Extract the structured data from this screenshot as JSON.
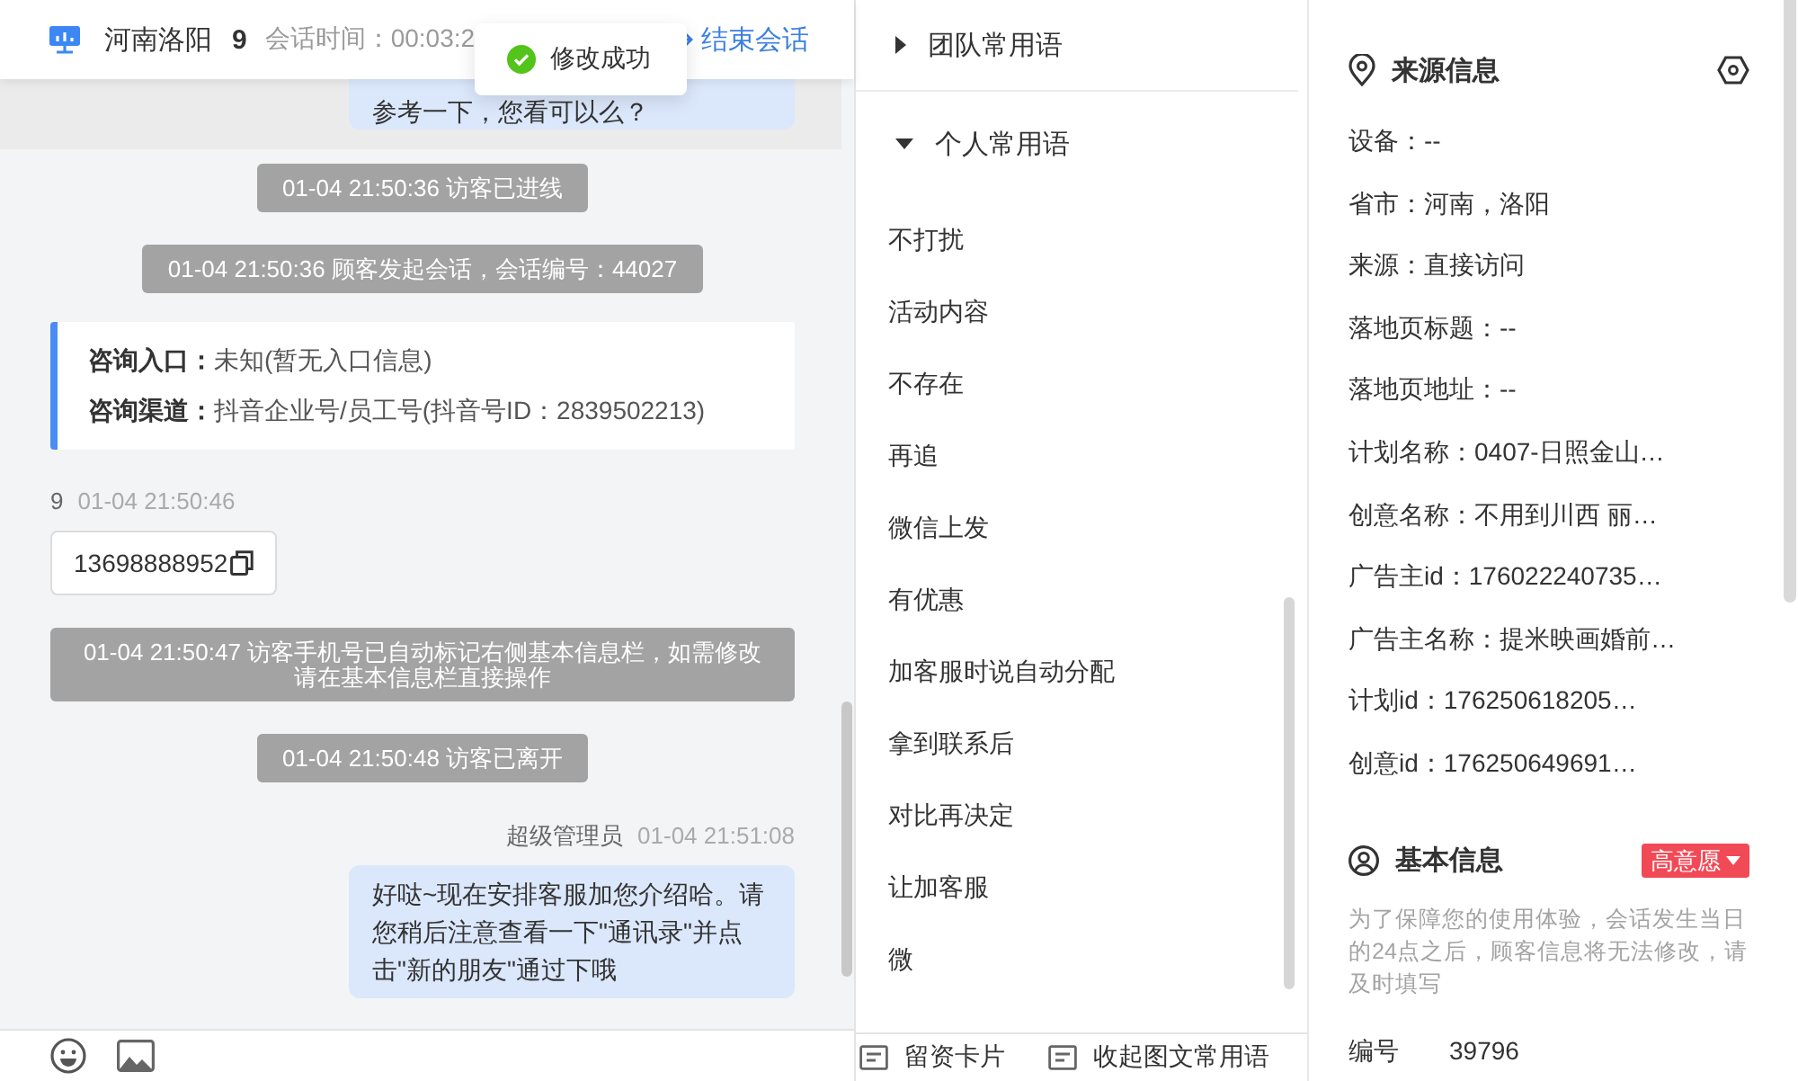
{
  "header": {
    "location": "河南洛阳",
    "visitor_number": "9",
    "session_time": "会话时间：00:03:2",
    "end_button": "结束会话"
  },
  "toast": {
    "message": "修改成功"
  },
  "chat": {
    "messages": [
      {
        "kind": "agent_partial",
        "text": "参考一下，您看可以么？"
      },
      {
        "kind": "system",
        "text": "01-04 21:50:36 访客已进线"
      },
      {
        "kind": "system",
        "text": "01-04 21:50:36 顾客发起会话，会话编号：44027"
      },
      {
        "kind": "info_card",
        "lines": [
          "**咨询入口：**未知(暂无入口信息)",
          "**咨询渠道：**抖音企业号/员工号(抖音号ID：2839502213)"
        ]
      },
      {
        "kind": "visitor",
        "sender": "9",
        "time": "01-04 21:50:46",
        "text": "13698888952"
      },
      {
        "kind": "system",
        "text": "01-04 21:50:47 访客手机号已自动标记右侧基本信息栏，如需修改请在基本信息栏直接操作"
      },
      {
        "kind": "system",
        "text": "01-04 21:50:48 访客已离开"
      },
      {
        "kind": "agent",
        "sender": "超级管理员",
        "time": "01-04 21:51:08",
        "text": "好哒~现在安排客服加您介绍哈。请您稍后注意查看一下\"通讯录\"并点击\"新的朋友\"通过下哦"
      }
    ]
  },
  "phrases": {
    "groups": [
      {
        "title": "团队常用语",
        "expanded": false
      },
      {
        "title": "个人常用语",
        "expanded": true,
        "items": [
          "不打扰",
          "活动内容",
          "不存在",
          "再追",
          "微信上发",
          "有优惠",
          "加客服时说自动分配",
          "拿到联系后",
          "对比再决定",
          "让加客服",
          "微"
        ]
      }
    ]
  },
  "phrase_actions": [
    "留资卡片",
    "收起图文常用语"
  ],
  "source_info": {
    "title": "来源信息",
    "fields": [
      "设备：--",
      "省市：河南，洛阳",
      "来源：直接访问",
      "落地页标题：--",
      "落地页地址：--",
      "计划名称：0407-日照金山…",
      "创意名称：不用到川西 丽…",
      "广告主id：176022240735…",
      "广告主名称：提米映画婚前…",
      "计划id：176250618205…",
      "创意id：176250649691…"
    ]
  },
  "basic_info": {
    "title": "基本信息",
    "intent_tag": "高意愿",
    "notice": "为了保障您的使用体验，会话发生当日的24点之后，顾客信息将无法修改，请及时填写",
    "fields": [
      {
        "label": "编号",
        "value": "39796"
      }
    ]
  }
}
